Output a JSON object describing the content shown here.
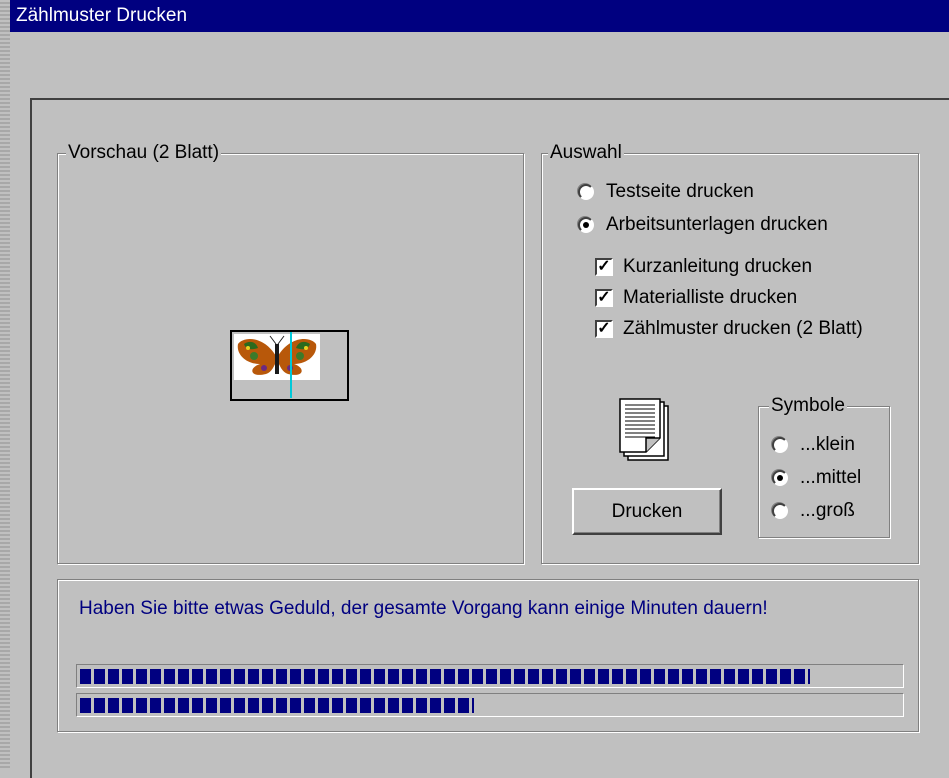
{
  "window": {
    "title": "Zählmuster Drucken"
  },
  "preview": {
    "legend": "Vorschau  (2 Blatt)"
  },
  "selection": {
    "legend": "Auswahl",
    "radios": [
      {
        "label": "Testseite drucken",
        "selected": false
      },
      {
        "label": "Arbeitsunterlagen drucken",
        "selected": true
      }
    ],
    "checkboxes": [
      {
        "label": "Kurzanleitung drucken",
        "checked": true
      },
      {
        "label": "Materialliste drucken",
        "checked": true
      },
      {
        "label": "Zählmuster drucken (2 Blatt)",
        "checked": true
      }
    ],
    "print_button": "Drucken",
    "document_icon": "document-icon"
  },
  "symbols": {
    "legend": "Symbole",
    "options": [
      {
        "label": "...klein",
        "selected": false
      },
      {
        "label": "...mittel",
        "selected": true
      },
      {
        "label": "...groß",
        "selected": false
      }
    ]
  },
  "status": {
    "message": "Haben Sie bitte etwas Geduld, der gesamte Vorgang kann einige Minuten dauern!",
    "progress_total": 0.89,
    "progress_current": 0.48,
    "progress_color": "#000080"
  }
}
